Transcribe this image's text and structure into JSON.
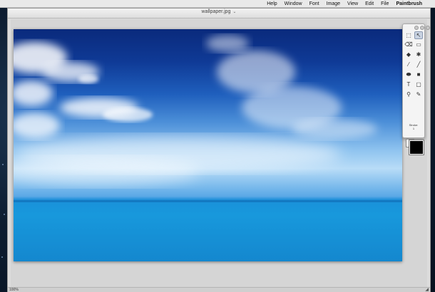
{
  "menubar": {
    "apple_icon": "",
    "app_name": "Paintbrush",
    "items": [
      "File",
      "Edit",
      "View",
      "Image",
      "Font",
      "Window",
      "Help"
    ]
  },
  "window": {
    "title": "wallpaper.jpg",
    "title_chevron": "⌄"
  },
  "tools_palette": {
    "tools": [
      {
        "name": "selection-tool",
        "glyph": "⬚",
        "active": false
      },
      {
        "name": "pointer-tool",
        "glyph": "↖",
        "active": true
      },
      {
        "name": "eraser-tool",
        "glyph": "⌫",
        "active": false
      },
      {
        "name": "rect-select-tool",
        "glyph": "▭",
        "active": false
      },
      {
        "name": "fill-bucket-tool",
        "glyph": "◆",
        "active": false
      },
      {
        "name": "airbrush-tool",
        "glyph": "✱",
        "active": false
      },
      {
        "name": "pencil-tool",
        "glyph": "⁄",
        "active": false
      },
      {
        "name": "line-tool",
        "glyph": "╱",
        "active": false
      },
      {
        "name": "ellipse-tool",
        "glyph": "⬬",
        "active": false
      },
      {
        "name": "rectangle-tool",
        "glyph": "■",
        "active": false
      },
      {
        "name": "text-tool",
        "glyph": "T",
        "active": false
      },
      {
        "name": "rounded-rect-tool",
        "glyph": "▢",
        "active": false
      },
      {
        "name": "zoom-tool",
        "glyph": "⚲",
        "active": false
      },
      {
        "name": "eyedropper-tool",
        "glyph": "✎",
        "active": false
      }
    ],
    "stroke_label": "Stroke:",
    "stroke_value": "1",
    "foreground_color": "#000000",
    "background_color": "#ffffff"
  },
  "statusbar": {
    "zoom": "100%",
    "resize_glyph": "◢"
  },
  "colors": {
    "sky_top": "#0a2a7c",
    "horizon": "#b8dcf7",
    "sea": "#1799dc"
  }
}
